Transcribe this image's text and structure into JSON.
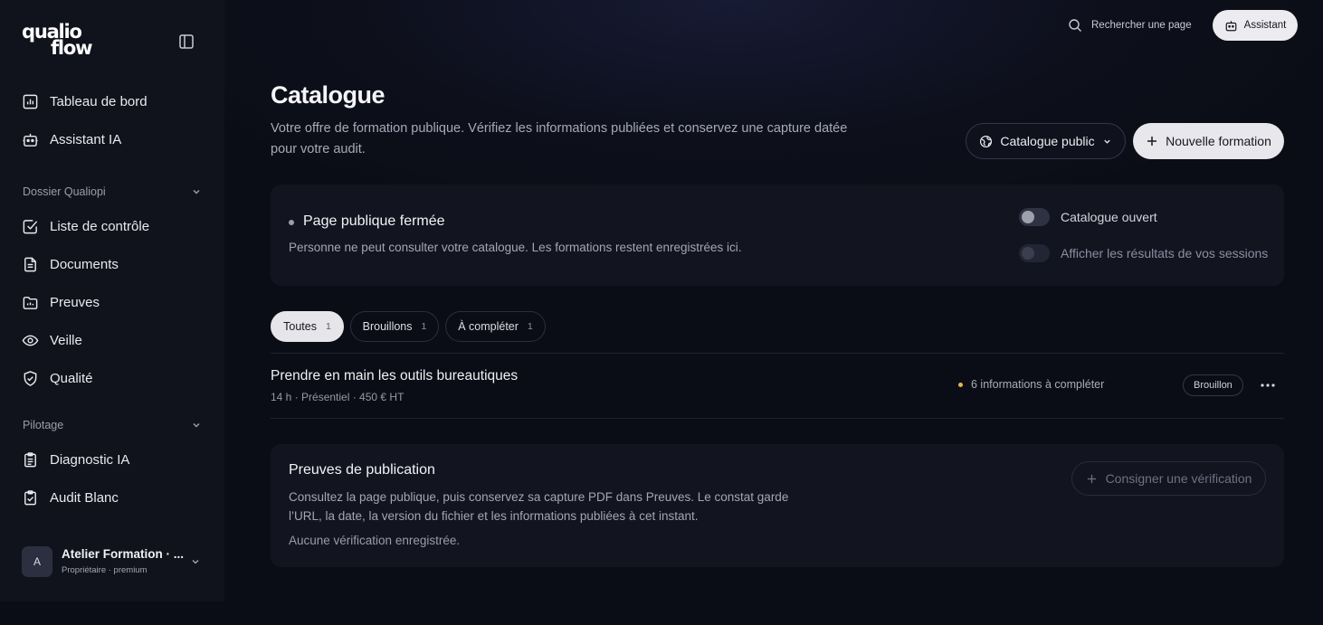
{
  "logo": {
    "line1": "qualio",
    "line2": "flow"
  },
  "sidebar": {
    "primary": [
      {
        "label": "Tableau de bord",
        "icon": "bar-chart-icon"
      },
      {
        "label": "Assistant IA",
        "icon": "robot-icon"
      }
    ],
    "section1": {
      "title": "Dossier Qualiopi",
      "items": [
        {
          "label": "Liste de contrôle",
          "icon": "checkbox-icon"
        },
        {
          "label": "Documents",
          "icon": "document-icon"
        },
        {
          "label": "Preuves",
          "icon": "folder-icon"
        },
        {
          "label": "Veille",
          "icon": "eye-icon"
        },
        {
          "label": "Qualité",
          "icon": "shield-check-icon"
        }
      ]
    },
    "section2": {
      "title": "Pilotage",
      "items": [
        {
          "label": "Diagnostic IA",
          "icon": "clipboard-icon"
        },
        {
          "label": "Audit Blanc",
          "icon": "clipboard-check-icon"
        }
      ]
    },
    "account": {
      "initial": "A",
      "name": "Atelier Formation · ...",
      "role": "Propriétaire · premium"
    }
  },
  "topbar": {
    "search_label": "Rechercher une page",
    "assistant_label": "Assistant"
  },
  "header": {
    "title": "Catalogue",
    "subtitle": "Votre offre de formation publique. Vérifiez les informations publiées et conservez une capture datée pour votre audit.",
    "catalogue_button": "Catalogue public",
    "new_button": "Nouvelle formation"
  },
  "status": {
    "title": "Page publique fermée",
    "description": "Personne ne peut consulter votre catalogue. Les formations restent enregistrées ici.",
    "toggles": [
      {
        "label": "Catalogue ouvert",
        "checked": false,
        "enabled": true
      },
      {
        "label": "Afficher les résultats de vos sessions",
        "checked": false,
        "enabled": false
      }
    ]
  },
  "filters": [
    {
      "label": "Toutes",
      "count": "1",
      "active": true
    },
    {
      "label": "Brouillons",
      "count": "1",
      "active": false
    },
    {
      "label": "À compléter",
      "count": "1",
      "active": false
    }
  ],
  "trainings": [
    {
      "title": "Prendre en main les outils bureautiques",
      "meta": "14 h · Présentiel · 450 € HT",
      "info": "6 informations à compléter",
      "badge": "Brouillon"
    }
  ],
  "proofs": {
    "title": "Preuves de publication",
    "description": "Consultez la page publique, puis conservez sa capture PDF dans Preuves. Le constat garde l’URL, la date, la version du fichier et les informations publiées à cet instant.",
    "empty": "Aucune vérification enregistrée.",
    "button": "Consigner une vérification"
  },
  "colors": {
    "accent_button": "#e8e8ec",
    "warning_dot": "#e6b54c",
    "background": "#0b0d16",
    "sidebar": "#11131c"
  }
}
